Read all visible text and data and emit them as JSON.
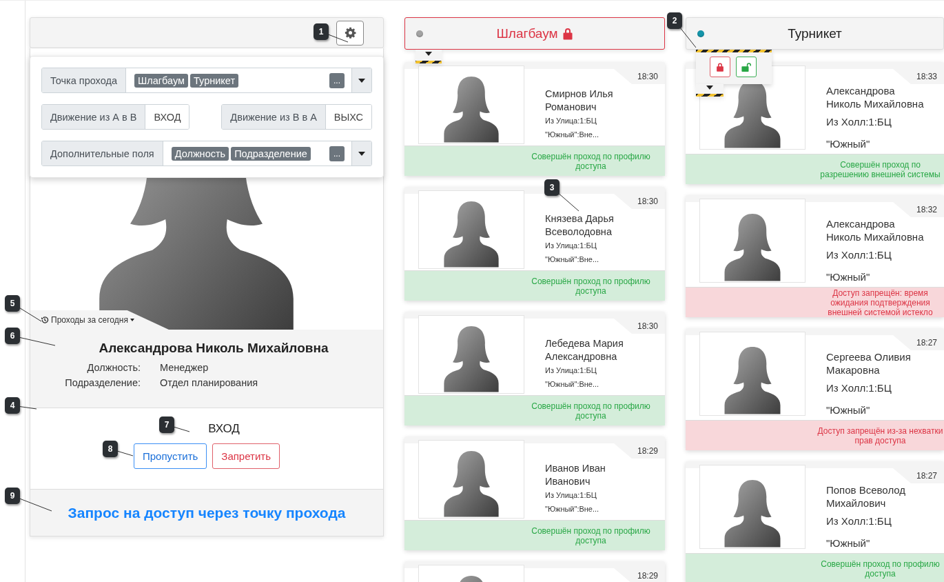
{
  "settings": {
    "open": true,
    "rows": [
      {
        "kind": "multi",
        "label": "Точка прохода",
        "tags": [
          "Шлагбаум",
          "Турникет"
        ],
        "more": "..."
      },
      {
        "kind": "pair",
        "fields": [
          {
            "label": "Движение из А в В",
            "value": "ВХОД"
          },
          {
            "label": "Движение из В в А",
            "value": "ВЫХС"
          }
        ]
      },
      {
        "kind": "multi",
        "label": "Дополнительные поля",
        "tags": [
          "Должность",
          "Подразделение"
        ],
        "more": "..."
      }
    ]
  },
  "left_panel": {
    "history_link": "Проходы за сегодня",
    "person": {
      "name": "Александрова Николь Михайловна",
      "fields": [
        {
          "label": "Должность:",
          "value": "Менеджер"
        },
        {
          "label": "Подразделение:",
          "value": "Отдел планирования"
        }
      ]
    },
    "direction": "ВХОД",
    "buttons": [
      {
        "label": "Пропустить",
        "kind": "allow"
      },
      {
        "label": "Запретить",
        "kind": "deny"
      }
    ],
    "footer_title": "Запрос на доступ через точку прохода"
  },
  "access_points": [
    {
      "title": "Шлагбаум",
      "locked": true,
      "color": "#a3a3a3",
      "controls_expanded": false,
      "events": [
        {
          "time": "18:30",
          "name": "Смирнов Илья Романович",
          "location_lines": [
            "Из Улица:1:БЦ",
            "\"Южный\":Вне..."
          ],
          "kind": "success",
          "message": "Совершён проход по профилю доступа"
        },
        {
          "time": "18:30",
          "name": "Князева Дарья Всеволодовна",
          "location_lines": [
            "Из Улица:1:БЦ",
            "\"Южный\":Вне..."
          ],
          "kind": "success",
          "message": "Совершён проход по профилю доступа"
        },
        {
          "time": "18:30",
          "name": "Лебедева Мария Александровна",
          "location_lines": [
            "Из Улица:1:БЦ",
            "\"Южный\":Вне..."
          ],
          "kind": "success",
          "message": "Совершён проход по профилю доступа"
        },
        {
          "time": "18:29",
          "name": "Иванов Иван Иванович",
          "location_lines": [
            "Из Улица:1:БЦ",
            "\"Южный\":Вне..."
          ],
          "kind": "success",
          "message": "Совершён проход по профилю доступа"
        },
        {
          "time": "18:29"
        }
      ]
    },
    {
      "title": "Турникет",
      "locked": false,
      "color": "#1495aa",
      "controls_expanded": true,
      "events": [
        {
          "time": "18:33",
          "name": "Александрова Николь Михайловна",
          "location_lines": [
            "Из Холл:1:БЦ",
            "\"Южный\""
          ],
          "kind": "success",
          "message": "Совершён проход по разрешению внешней системы"
        },
        {
          "time": "18:32",
          "name": "Александрова Николь Михайловна",
          "location_lines": [
            "Из Холл:1:БЦ",
            "\"Южный\""
          ],
          "kind": "denied",
          "message": "Доступ запрещён: время ожидания подтверждения внешней системой истекло"
        },
        {
          "time": "18:27",
          "name": "Сергеева Оливия Макаровна",
          "location_lines": [
            "Из Холл:1:БЦ",
            "\"Южный\""
          ],
          "kind": "denied",
          "message": "Доступ запрещён из-за нехватки прав доступа"
        },
        {
          "time": "18:27",
          "name": "Попов Всеволод Михайлович",
          "location_lines": [
            "Из Холл:1:БЦ",
            "\"Южный\""
          ],
          "kind": "success",
          "message": "Совершён проход по профилю доступа"
        }
      ]
    }
  ],
  "callouts": [
    {
      "number": "1"
    },
    {
      "number": "2"
    },
    {
      "number": "3"
    },
    {
      "number": "5"
    },
    {
      "number": "6"
    },
    {
      "number": "4"
    },
    {
      "number": "7"
    },
    {
      "number": "8"
    },
    {
      "number": "9"
    }
  ]
}
